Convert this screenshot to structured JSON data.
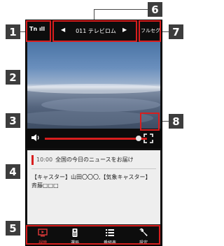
{
  "callouts": [
    "1",
    "2",
    "3",
    "4",
    "5",
    "6",
    "7",
    "8"
  ],
  "status": {
    "signal_text": "Tn ıll"
  },
  "channel": {
    "prev_arrow": "◀",
    "label": "011 テレビロム",
    "next_arrow": "▶"
  },
  "fullseg_label": "フルセグ",
  "volume": {
    "level": 0.92
  },
  "program": {
    "time": "10:00",
    "title": "全国の今日のニュースをお届け",
    "body": "【キャスター】山田〇〇〇,【気象キャスター】斉藤□□□"
  },
  "nav": [
    {
      "label": "視聴",
      "icon": "tv-icon",
      "active": true
    },
    {
      "label": "選局",
      "icon": "remote-icon",
      "active": false
    },
    {
      "label": "番組表",
      "icon": "list-icon",
      "active": false
    },
    {
      "label": "設定",
      "icon": "wrench-icon",
      "active": false
    }
  ],
  "colors": {
    "accent": "#d81e1e",
    "callout": "#3d3d3d",
    "background": "#111111"
  }
}
